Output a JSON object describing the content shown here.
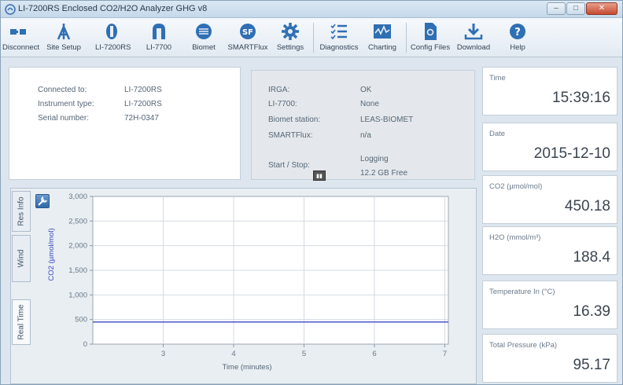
{
  "window": {
    "title": "LI-7200RS Enclosed CO2/H2O Analyzer GHG v8"
  },
  "toolbar": {
    "items": [
      {
        "label": "Disconnect",
        "icon": "disconnect-icon"
      },
      {
        "label": "Site Setup",
        "icon": "site-setup-icon"
      },
      {
        "label": "LI-7200RS",
        "icon": "li7200rs-icon"
      },
      {
        "label": "LI-7700",
        "icon": "li7700-icon"
      },
      {
        "label": "Biomet",
        "icon": "biomet-icon"
      },
      {
        "label": "SMARTFlux",
        "icon": "smartflux-icon"
      },
      {
        "label": "Settings",
        "icon": "gear-icon"
      },
      {
        "label": "Diagnostics",
        "icon": "diagnostics-icon"
      },
      {
        "label": "Charting",
        "icon": "charting-icon"
      },
      {
        "label": "Config Files",
        "icon": "config-files-icon"
      },
      {
        "label": "Download",
        "icon": "download-icon"
      },
      {
        "label": "Help",
        "icon": "help-icon"
      }
    ]
  },
  "connection": {
    "connected_to_label": "Connected to:",
    "connected_to_value": "LI-7200RS",
    "instrument_type_label": "Instrument type:",
    "instrument_type_value": "LI-7200RS",
    "serial_label": "Serial number:",
    "serial_value": "72H-0347"
  },
  "status": {
    "irga_label": "IRGA:",
    "irga_value": "OK",
    "li7700_label": "LI-7700:",
    "li7700_value": "None",
    "biomet_label": "Biomet station:",
    "biomet_value": "LEAS-BIOMET",
    "smartflux_label": "SMARTFlux:",
    "smartflux_value": "n/a",
    "startstop_label": "Start / Stop:",
    "logging_text": "Logging",
    "free_text": "12.2 GB Free"
  },
  "tabs": [
    {
      "label": "Res Info"
    },
    {
      "label": "Wind"
    },
    {
      "label": "Real Time"
    }
  ],
  "chart_data": {
    "type": "line",
    "xlabel": "Time (minutes)",
    "ylabel": "CO2 (µmol/mol)",
    "xlim": [
      2,
      7.05
    ],
    "ylim": [
      0,
      3000
    ],
    "xticks": [
      "3",
      "4",
      "5",
      "6",
      "7"
    ],
    "yticks": [
      "3,000",
      "2,500",
      "2,000",
      "1,500",
      "1,000",
      "500",
      "0"
    ],
    "series": [
      {
        "x": [
          2,
          7.05
        ],
        "y": [
          450.18,
          450.18
        ],
        "color": "#3b46c8"
      }
    ],
    "grid": true
  },
  "readouts": [
    {
      "label": "Time",
      "value": "15:39:16"
    },
    {
      "label": "Date",
      "value": "2015-12-10"
    },
    {
      "label": "CO2 (µmol/mol)",
      "value": "450.18"
    },
    {
      "label": "H2O (mmol/m³)",
      "value": "188.4"
    },
    {
      "label": "Temperature In (°C)",
      "value": "16.39"
    },
    {
      "label": "Total Pressure (kPa)",
      "value": "95.17"
    }
  ]
}
